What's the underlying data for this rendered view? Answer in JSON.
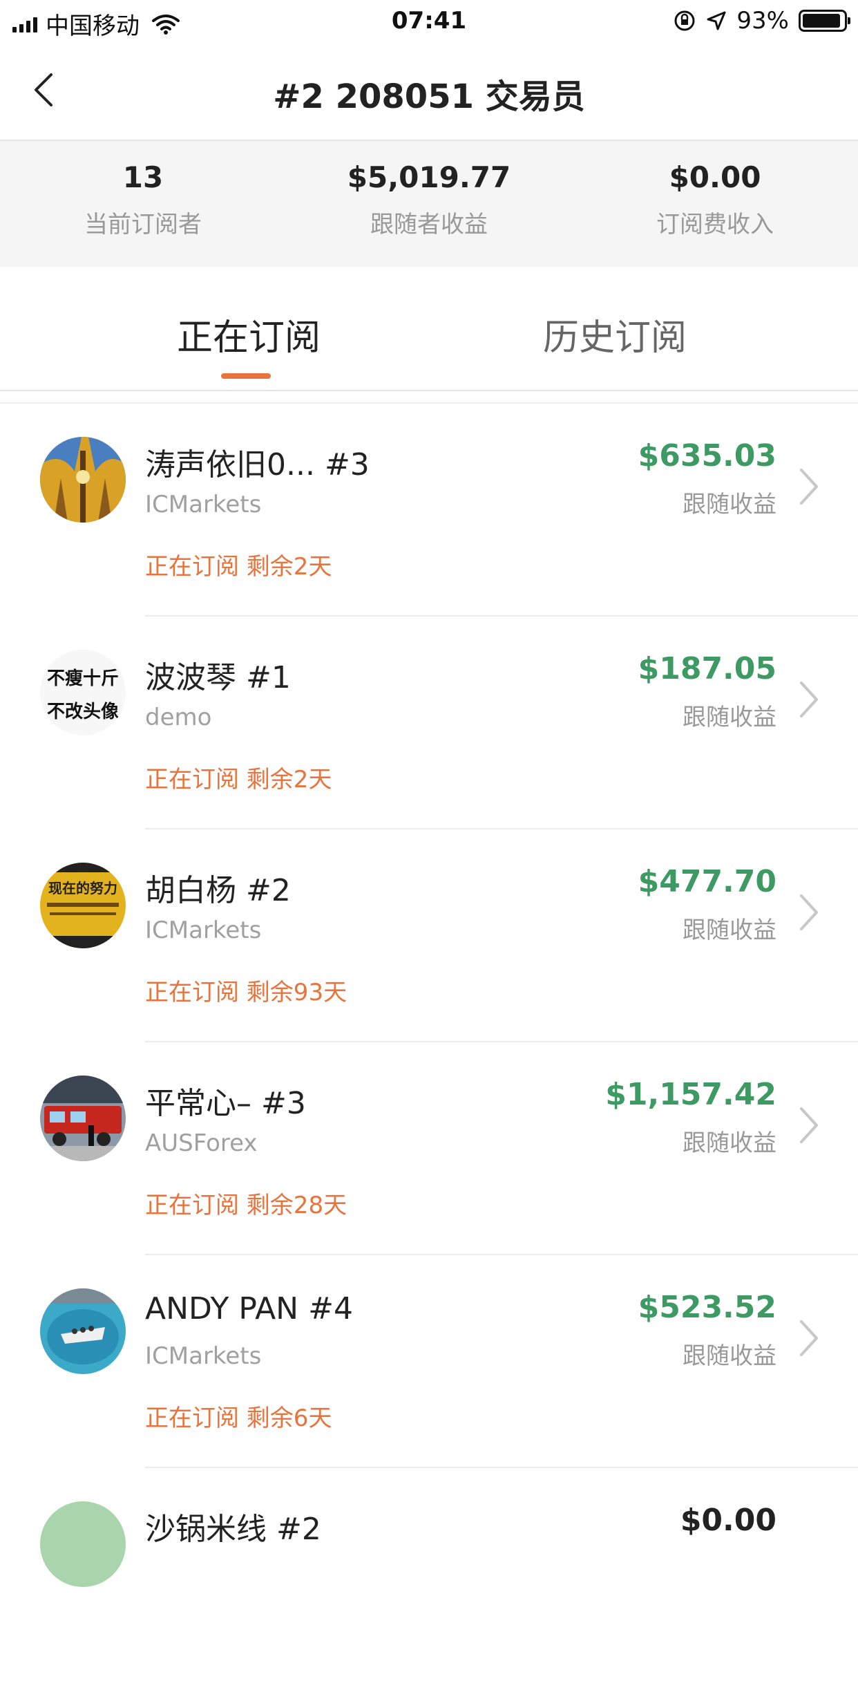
{
  "status_bar": {
    "carrier": "中国移动",
    "time": "07:41",
    "battery": "93%",
    "battery_level": 0.93,
    "icons": [
      "signal-icon",
      "wifi-icon",
      "orientation-lock-icon",
      "location-icon",
      "battery-icon"
    ]
  },
  "nav": {
    "title": "#2 208051 交易员",
    "back_icon": "chevron-left-icon"
  },
  "stats": [
    {
      "value": "13",
      "label": "当前订阅者"
    },
    {
      "value": "$5,019.77",
      "label": "跟随者收益"
    },
    {
      "value": "$0.00",
      "label": "订阅费收入"
    }
  ],
  "tabs": [
    {
      "label": "正在订阅",
      "active": true
    },
    {
      "label": "历史订阅",
      "active": false
    }
  ],
  "colors": {
    "accent": "#e8733c",
    "profit": "#3d9a63"
  },
  "subscribers": [
    {
      "name": "涛声依旧0...   #3",
      "broker": "ICMarkets",
      "status": "正在订阅 剩余2天",
      "amount": "$635.03",
      "amount_label": "跟随收益",
      "avatar": "forest-photo"
    },
    {
      "name": "波波琴 #1",
      "broker": "demo",
      "status": "正在订阅 剩余2天",
      "amount": "$187.05",
      "amount_label": "跟随收益",
      "avatar": "text-image",
      "avatar_text_top": "不瘦十斤",
      "avatar_text_bottom": "不改头像"
    },
    {
      "name": "胡白杨 #2",
      "broker": "ICMarkets",
      "status": "正在订阅 剩余93天",
      "amount": "$477.70",
      "amount_label": "跟随收益",
      "avatar": "sign-photo",
      "avatar_text_top": "现在的努力"
    },
    {
      "name": "平常心– #3",
      "broker": "AUSForex",
      "status": "正在订阅 剩余28天",
      "amount": "$1,157.42",
      "amount_label": "跟随收益",
      "avatar": "fire-truck-photo"
    },
    {
      "name": "ANDY PAN #4",
      "broker": "ICMarkets",
      "status": "正在订阅 剩余6天",
      "amount": "$523.52",
      "amount_label": "跟随收益",
      "avatar": "lake-boat-photo"
    },
    {
      "name": "沙锅米线 #2",
      "broker": "",
      "status": "",
      "amount": "$0.00",
      "amount_label": "",
      "avatar": "plain-green"
    }
  ]
}
